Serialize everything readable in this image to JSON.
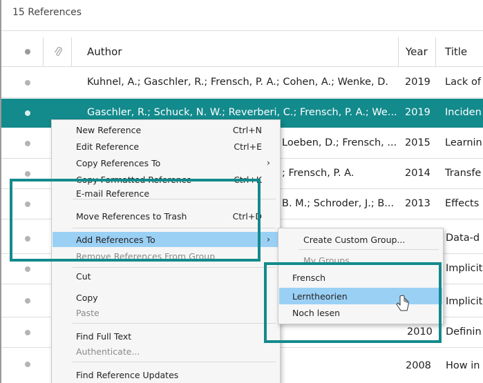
{
  "ref_count": "15 References",
  "columns": {
    "author": "Author",
    "year": "Year",
    "title": "Title"
  },
  "rows": [
    {
      "author": "Kuhnel, A.; Gaschler, R.; Frensch, P. A.; Cohen, A.; Wenke, D.",
      "year": "2019",
      "title": "Lack of"
    },
    {
      "author": "Gaschler, R.; Schuck, N. W.; Reverberi, C.; Frensch, P. A.; We...",
      "year": "2019",
      "title": "Inciden"
    },
    {
      "author": "Loeben, D.; Frensch, ...",
      "year": "2015",
      "title": "Learnin"
    },
    {
      "author": "; Frensch, P. A.",
      "year": "2014",
      "title": "Transfe"
    },
    {
      "author": "B. M.; Schroder, J.; B...",
      "year": "2013",
      "title": "Effects"
    },
    {
      "author": "",
      "year": "",
      "title": "Data-d"
    },
    {
      "author": "",
      "year": "",
      "title": "Implicit"
    },
    {
      "author": "",
      "year": "",
      "title": "Implicit"
    },
    {
      "author": "",
      "year": "2010",
      "title": "Definin"
    },
    {
      "author": "",
      "year": "2008",
      "title": "How in"
    }
  ],
  "context_menu": {
    "new_reference": "New Reference",
    "new_reference_sc": "Ctrl+N",
    "edit_reference": "Edit Reference",
    "edit_reference_sc": "Ctrl+E",
    "copy_references_to": "Copy References To",
    "copy_formatted": "Copy Formatted Reference",
    "copy_formatted_sc": "Ctrl+K",
    "email_reference": "E-mail Reference",
    "move_to_trash": "Move References to Trash",
    "move_to_trash_sc": "Ctrl+D",
    "add_references_to": "Add References To",
    "remove_from_group": "Remove References From Group",
    "cut": "Cut",
    "copy": "Copy",
    "paste": "Paste",
    "find_full_text": "Find Full Text",
    "authenticate": "Authenticate...",
    "find_updates": "Find Reference Updates"
  },
  "submenu": {
    "create_custom_group": "Create Custom Group...",
    "my_groups": "My Groups",
    "groups": [
      "Frensch",
      "Lerntheorien",
      "Noch lesen"
    ]
  },
  "colors": {
    "accent": "#138a8c",
    "highlight": "#9bd0f5"
  }
}
